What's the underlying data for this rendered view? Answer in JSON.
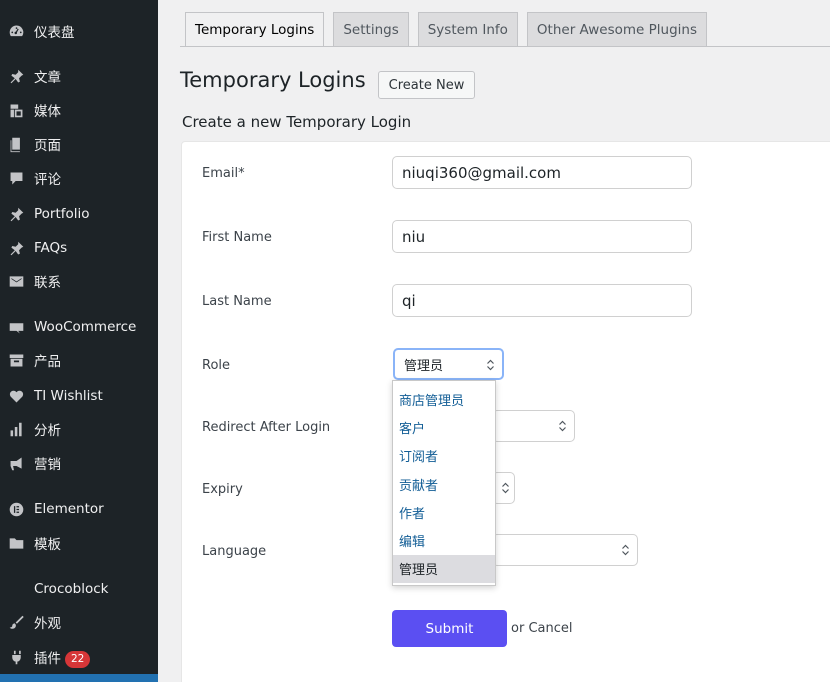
{
  "sidebar": {
    "items": [
      {
        "label": "仪表盘",
        "icon": "dashboard-icon"
      },
      {
        "label": "文章",
        "icon": "pin-icon"
      },
      {
        "label": "媒体",
        "icon": "media-icon"
      },
      {
        "label": "页面",
        "icon": "page-icon"
      },
      {
        "label": "评论",
        "icon": "comment-icon"
      },
      {
        "label": "Portfolio",
        "icon": "pin-icon"
      },
      {
        "label": "FAQs",
        "icon": "pin-icon"
      },
      {
        "label": "联系",
        "icon": "mail-icon"
      },
      {
        "label": "WooCommerce",
        "icon": "woocommerce-icon"
      },
      {
        "label": "产品",
        "icon": "archive-icon"
      },
      {
        "label": "TI Wishlist",
        "icon": "heart-icon"
      },
      {
        "label": "分析",
        "icon": "bar-chart-icon"
      },
      {
        "label": "营销",
        "icon": "megaphone-icon"
      },
      {
        "label": "Elementor",
        "icon": "elementor-icon"
      },
      {
        "label": "模板",
        "icon": "folder-icon"
      },
      {
        "label": "Crocoblock",
        "icon": ""
      },
      {
        "label": "外观",
        "icon": "brush-icon"
      },
      {
        "label": "插件",
        "icon": "plugin-icon",
        "badge": "22"
      }
    ]
  },
  "tabs": [
    {
      "label": "Temporary Logins",
      "active": true
    },
    {
      "label": "Settings",
      "active": false
    },
    {
      "label": "System Info",
      "active": false
    },
    {
      "label": "Other Awesome Plugins",
      "active": false
    }
  ],
  "page": {
    "title": "Temporary Logins",
    "create_new_label": "Create New",
    "section_title": "Create a new Temporary Login"
  },
  "form": {
    "email_label": "Email*",
    "email_value": "niuqi360@gmail.com",
    "first_name_label": "First Name",
    "first_name_value": "niu",
    "last_name_label": "Last Name",
    "last_name_value": "qi",
    "role_label": "Role",
    "role_value": "管理员",
    "role_options": [
      "商店管理员",
      "客户",
      "订阅者",
      "贡献者",
      "作者",
      "编辑",
      "管理员"
    ],
    "redirect_label": "Redirect After Login",
    "expiry_label": "Expiry",
    "language_label": "Language",
    "submit_label": "Submit",
    "or_text": "or",
    "cancel_label": "Cancel"
  },
  "colors": {
    "sidebar_bg": "#1d2327",
    "submit_bg": "#5b4ff2",
    "badge_bg": "#d63638",
    "link": "#135e96"
  }
}
